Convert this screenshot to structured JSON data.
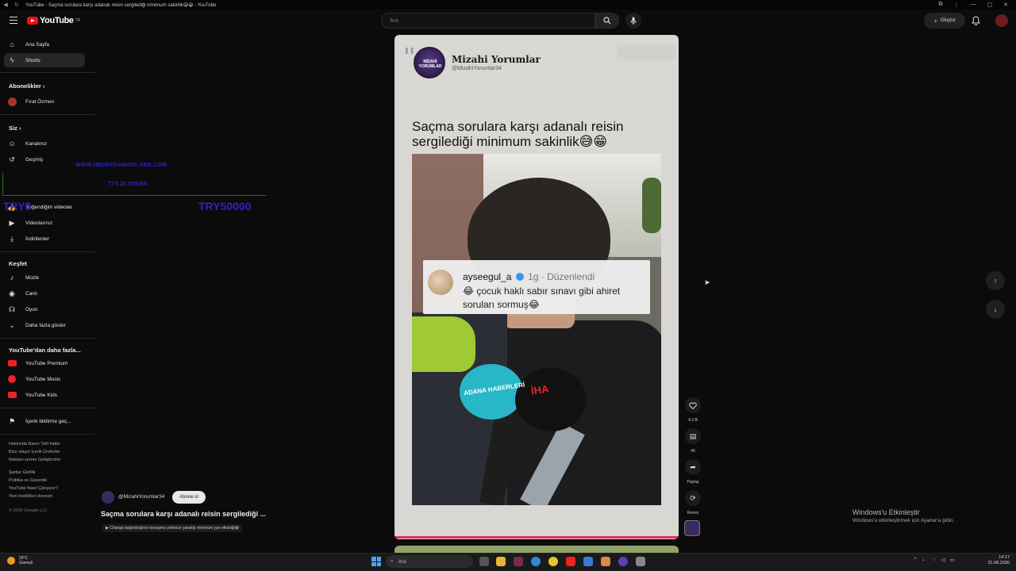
{
  "browser": {
    "tab_title": "YouTube - Saçma sorulara karşı adanalı reisin sergilediği minimum sakinlik😅😁 - YouTube"
  },
  "header": {
    "logo_text": "YouTube",
    "logo_sup": "TR",
    "search_placeholder": "Ara",
    "create_label": "Oluştur"
  },
  "sidebar": {
    "home": "Ana Sayfa",
    "shorts": "Shorts",
    "subs_heading": "Abonelikler",
    "sub_channel": "Fırat Özmen",
    "you_heading": "Siz",
    "your_channel": "Kanalınız",
    "history": "Geçmiş",
    "liked": "Beğendiğim videolar",
    "your_videos": "Videolarınız",
    "downloads": "İndirilenler",
    "explore_heading": "Keşfet",
    "music": "Müzik",
    "live": "Canlı",
    "gaming": "Oyun",
    "show_more": "Daha fazla göster",
    "more_heading": "YouTube'dan daha fazla...",
    "premium": "YouTube Premium",
    "yt_music": "YouTube Music",
    "kids": "YouTube Kids",
    "report": "İçerik bildirme geç...",
    "footer1": "Hakkında  Basın  Telif hakkı",
    "footer2": "Bize ulaşın  İçerik Üreticiler",
    "footer3": "Reklam verme  Geliştiriciler",
    "footer4": "Şartlar  Gizlilik",
    "footer5": "Politika ve Güvenlik",
    "footer6": "YouTube Nasıl Çalışıyor?",
    "footer7": "Yeni özellikleri deneyin",
    "copyright": "© 2026 Google LLC"
  },
  "stream_overlay": {
    "line1": "WWW.HEDEFGAMING.SEN.COM",
    "line2": "TTS 20 TOKEN",
    "left_amount": "TRY0",
    "right_amount": "TRY50000"
  },
  "short": {
    "channel_name": "Mizahi Yorumlar",
    "channel_handle": "@MizahiYorumlar34",
    "avatar_text": "MİZAHİ YORUMLAR",
    "headline": "Saçma sorulara karşı adanalı reisin sergilediği minimum sakinlik😅😁",
    "comment_user": "ayseegul_a",
    "comment_meta": "1g · Düzenlendi",
    "comment_text": "😂 çocuk haklı sabır sınavı gibi ahiret soruları sormuş😂",
    "mic_label_1": "ADANA HABERLERİ",
    "mic_label_2": "İHA"
  },
  "actions": {
    "likes": "4,3 B",
    "comments": "40",
    "share": "Paylaş",
    "remix": "Remix"
  },
  "video_meta": {
    "handle": "@MizahiYorumlar34",
    "subscribe": "Abone ol",
    "title": "Saçma sorulara karşı adanalı reisin sergilediği ...",
    "music": "▶ Change bağımlılığının konuşma yetimize yaratığı minimum yan etkisi😅😁"
  },
  "windows": {
    "activate_title": "Windows'u Etkinleştir",
    "activate_sub": "Windows'u etkinleştirmek için Ayarlar'a gidin.",
    "weather_temp": "29°C",
    "weather_desc": "Güneşli",
    "search": "Ara",
    "time": "14:17",
    "date": "31.08.2026"
  },
  "colors": {
    "brand_red": "#ff0000",
    "progress": "#e52d5d",
    "overlay_blue": "#2d23c8"
  }
}
